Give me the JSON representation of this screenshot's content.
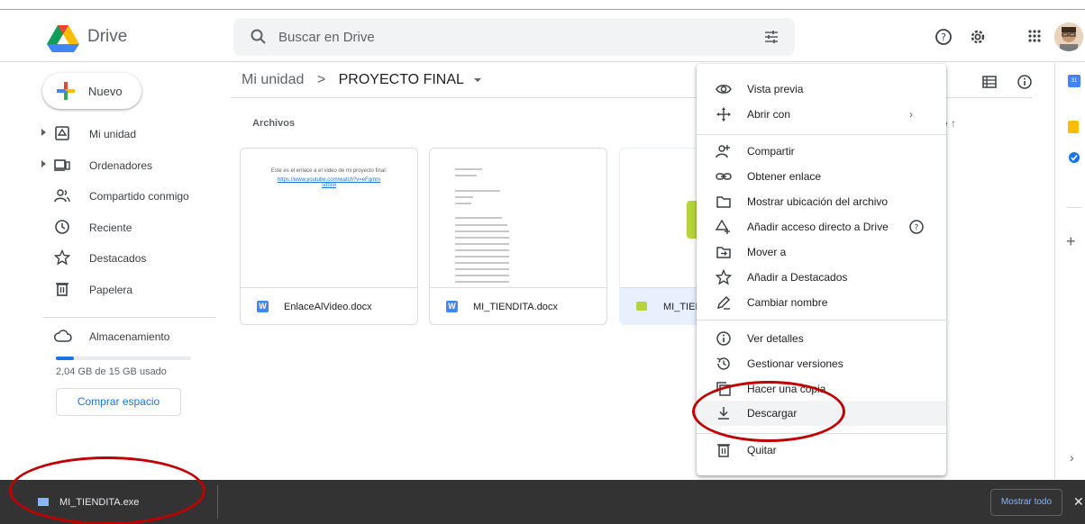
{
  "header": {
    "brand": "Drive",
    "search_placeholder": "Buscar en Drive"
  },
  "sidebar": {
    "new_label": "Nuevo",
    "items": [
      {
        "label": "Mi unidad",
        "icon": "drive-icon",
        "expandable": true
      },
      {
        "label": "Ordenadores",
        "icon": "computer-icon",
        "expandable": true
      },
      {
        "label": "Compartido conmigo",
        "icon": "people-icon",
        "expandable": false
      },
      {
        "label": "Reciente",
        "icon": "clock-icon",
        "expandable": false
      },
      {
        "label": "Destacados",
        "icon": "star-icon",
        "expandable": false
      },
      {
        "label": "Papelera",
        "icon": "trash-icon",
        "expandable": false
      }
    ],
    "storage_label": "Almacenamiento",
    "storage_used": "2,04 GB de 15 GB usado",
    "storage_fraction": 0.136,
    "buy_label": "Comprar espacio"
  },
  "main": {
    "breadcrumb_root": "Mi unidad",
    "breadcrumb_sep": ">",
    "breadcrumb_current": "PROYECTO FINAL",
    "section_title": "Archivos",
    "sort_label": "e ↑",
    "files": [
      {
        "name": "EnlaceAlVideo.docx",
        "type": "docx",
        "preview_text": "Este es el enlace a el video de mi proyecto final:",
        "preview_link": "https://www.youtube.com/watch?v=eFgmm sdf39i"
      },
      {
        "name": "MI_TIENDITA.docx",
        "type": "docx"
      },
      {
        "name": "MI_TIEN",
        "type": "exe"
      }
    ]
  },
  "context_menu": {
    "items": [
      {
        "label": "Vista previa",
        "icon": "eye-icon"
      },
      {
        "label": "Abrir con",
        "icon": "move-arrows-icon",
        "chevron": "›"
      },
      {
        "label": "Compartir",
        "icon": "person-add-icon"
      },
      {
        "label": "Obtener enlace",
        "icon": "link-icon"
      },
      {
        "label": "Mostrar ubicación del archivo",
        "icon": "folder-icon"
      },
      {
        "label": "Añadir acceso directo a Drive",
        "icon": "shortcut-icon"
      },
      {
        "label": "Mover a",
        "icon": "move-to-icon"
      },
      {
        "label": "Añadir a Destacados",
        "icon": "star-icon"
      },
      {
        "label": "Cambiar nombre",
        "icon": "pencil-icon"
      },
      {
        "label": "Ver detalles",
        "icon": "info-icon"
      },
      {
        "label": "Gestionar versiones",
        "icon": "history-icon"
      },
      {
        "label": "Hacer una copia",
        "icon": "copy-icon"
      },
      {
        "label": "Descargar",
        "icon": "download-icon"
      },
      {
        "label": "Quitar",
        "icon": "trash-icon"
      }
    ]
  },
  "download_bar": {
    "file_name": "MI_TIENDITA.exe",
    "show_all": "Mostrar todo",
    "close": "✕"
  },
  "colors": {
    "accent": "#1a73e8",
    "annotation": "#c00000",
    "download_bar": "#333333"
  }
}
